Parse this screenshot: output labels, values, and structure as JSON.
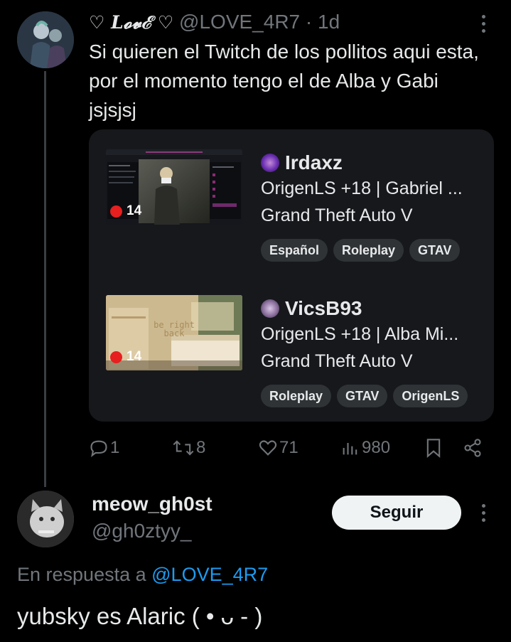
{
  "tweet1": {
    "display_name": "♡ L𝓸𝓿ℰ ♡",
    "handle": "@LOVE_4R7",
    "separator": "·",
    "time": "1d",
    "text": "Si quieren el Twitch de los pollitos aqui esta, por el momento tengo el de Alba y Gabi jsjsjsj",
    "card": {
      "streams": [
        {
          "viewers": "14",
          "channel": "Irdaxz",
          "title": "OrigenLS +18 | Gabriel ...",
          "game": "Grand Theft Auto V",
          "tags": [
            "Español",
            "Roleplay",
            "GTAV"
          ],
          "channel_icon_color": "#6b2fb3"
        },
        {
          "viewers": "14",
          "channel": "VicsB93",
          "title": "OrigenLS +18 | Alba Mi...",
          "game": "Grand Theft Auto V",
          "tags": [
            "Roleplay",
            "GTAV",
            "OrigenLS"
          ],
          "channel_icon_color": "#8a6f9c",
          "overlay_text": "be right back"
        }
      ]
    },
    "actions": {
      "replies": "1",
      "reposts": "8",
      "likes": "71",
      "views": "980"
    }
  },
  "tweet2": {
    "display_name": "meow_gh0st",
    "handle": "@gh0ztyy_",
    "follow_label": "Seguir",
    "reply_prefix": "En respuesta a",
    "reply_mention": "@LOVE_4R7",
    "text": "yubsky es Alaric ( • ᴗ - )"
  },
  "colors": {
    "background": "#000000",
    "text": "#e7e9ea",
    "muted": "#71767b",
    "link": "#1d9bf0",
    "card": "#16181c",
    "live_red": "#e61f1f"
  }
}
